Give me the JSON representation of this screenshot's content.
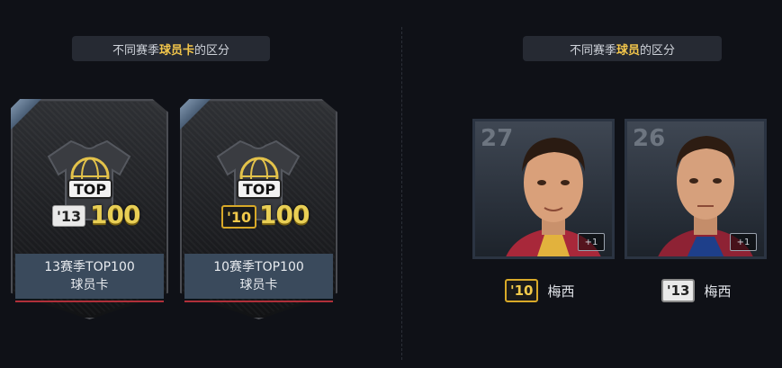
{
  "left_section": {
    "title_prefix": "不同赛季",
    "title_highlight": "球员卡",
    "title_suffix": "的区分",
    "packs": [
      {
        "season_tag": "'13",
        "top_text": "TOP",
        "big_text": "100",
        "label_line1": "13赛季TOP100",
        "label_line2": "球员卡",
        "tag_style": "silver"
      },
      {
        "season_tag": "'10",
        "top_text": "TOP",
        "big_text": "100",
        "label_line1": "10赛季TOP100",
        "label_line2": "球员卡",
        "tag_style": "gold"
      }
    ]
  },
  "right_section": {
    "title_prefix": "不同赛季",
    "title_highlight": "球员",
    "title_suffix": "的区分",
    "players": [
      {
        "number": "27",
        "plus": "+1",
        "season_tag": "'10",
        "name": "梅西",
        "tag_style": "gold"
      },
      {
        "number": "26",
        "plus": "+1",
        "season_tag": "'13",
        "name": "梅西",
        "tag_style": "silver"
      }
    ]
  },
  "colors": {
    "background": "#0f1117",
    "highlight": "#f3c64b",
    "title_bg": "#262a33",
    "label_bg": "#3a4a5c"
  }
}
